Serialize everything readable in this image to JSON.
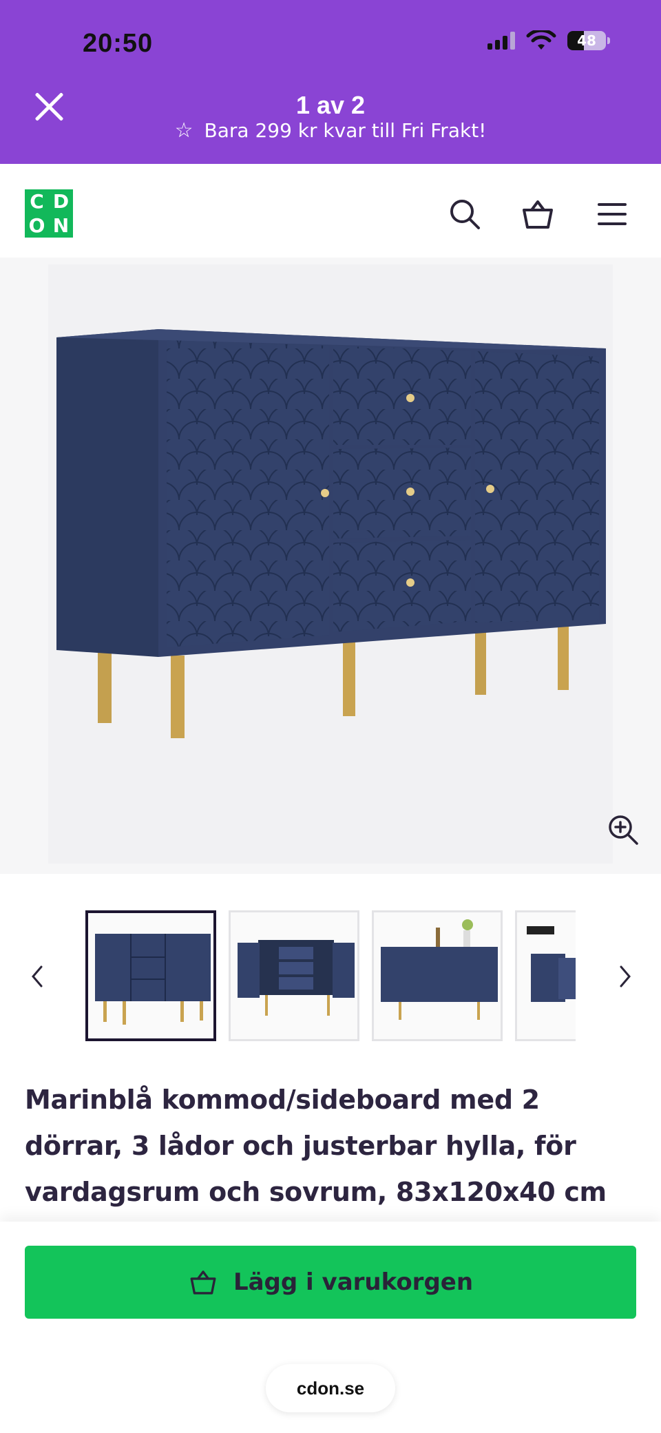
{
  "status_bar": {
    "time": "20:50",
    "battery": "48"
  },
  "overlay_header": {
    "pager": "1 av 2",
    "promo": "Bara 299 kr kvar till Fri Frakt!"
  },
  "nav": {
    "logo_letters": [
      "C",
      "D",
      "O",
      "N"
    ],
    "icons": [
      "search-icon",
      "basket-icon",
      "hamburger-menu-icon"
    ]
  },
  "product": {
    "title": "Marinblå kommod/sideboard med 2 dörrar, 3 lådor och justerbar hylla, för vardagsrum och sovrum, 83x120x40 cm",
    "active_thumbnail_index": 0,
    "thumbnail_count_visible": 4
  },
  "actions": {
    "add_to_cart": "Lägg i varukorgen"
  },
  "browser": {
    "url": "cdon.se"
  },
  "colors": {
    "header_purple": "#8a44d4",
    "brand_green": "#12b85a",
    "cart_green": "#13c45a",
    "navy": "#2f3b5e",
    "gold": "#c9a350"
  }
}
